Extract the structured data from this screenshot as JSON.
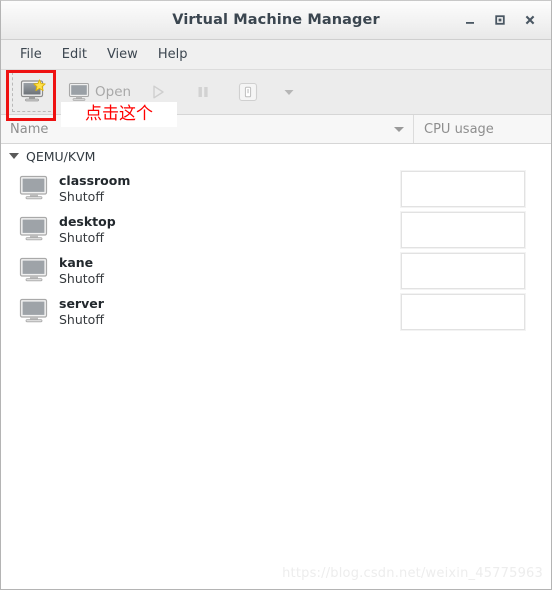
{
  "window": {
    "title": "Virtual Machine Manager",
    "controls": [
      {
        "name": "minimize",
        "glyph": "_"
      },
      {
        "name": "maximize",
        "glyph": "□"
      },
      {
        "name": "close",
        "glyph": "×"
      }
    ]
  },
  "menubar": {
    "items": [
      {
        "label": "File"
      },
      {
        "label": "Edit"
      },
      {
        "label": "View"
      },
      {
        "label": "Help"
      }
    ]
  },
  "toolbar": {
    "new_vm_label": "",
    "new_vm_icon": "new-virtual-machine-icon",
    "open_label": "Open",
    "open_icon": "monitor-icon",
    "run_icon": "play-triangle-icon",
    "pause_icon": "pause-bars-icon",
    "shutdown_icon": "shutdown-icon",
    "menu_icon": "chevron-down-icon"
  },
  "annotation": {
    "text": "点击这个",
    "color": "#ff0000",
    "box_color": "#ee1111"
  },
  "columns": {
    "name_header": "Name",
    "cpu_header": "CPU usage"
  },
  "connection": {
    "label": "QEMU/KVM",
    "expanded": true
  },
  "vms": [
    {
      "name": "classroom",
      "state": "Shutoff",
      "icon": "monitor-icon",
      "cpu_graph": ""
    },
    {
      "name": "desktop",
      "state": "Shutoff",
      "icon": "monitor-icon",
      "cpu_graph": ""
    },
    {
      "name": "kane",
      "state": "Shutoff",
      "icon": "monitor-icon",
      "cpu_graph": ""
    },
    {
      "name": "server",
      "state": "Shutoff",
      "icon": "monitor-icon",
      "cpu_graph": ""
    }
  ],
  "watermark": {
    "text": "https://blog.csdn.net/weixin_45775963"
  }
}
